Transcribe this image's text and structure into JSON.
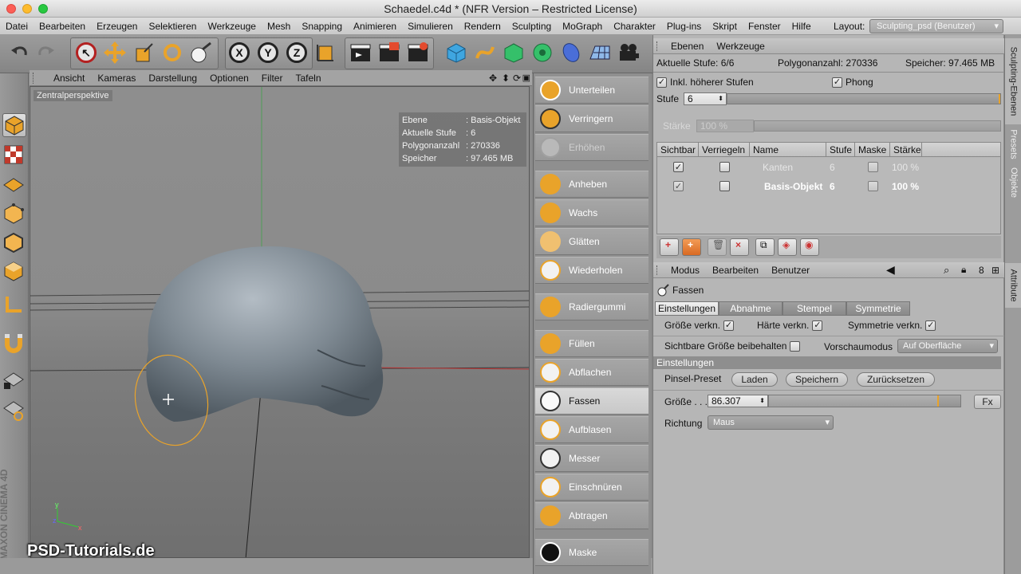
{
  "window": {
    "title": "Schaedel.c4d * (NFR Version – Restricted License)"
  },
  "menu": [
    "Datei",
    "Bearbeiten",
    "Erzeugen",
    "Selektieren",
    "Werkzeuge",
    "Mesh",
    "Snapping",
    "Animieren",
    "Simulieren",
    "Rendern",
    "Sculpting",
    "MoGraph",
    "Charakter",
    "Plug-ins",
    "Skript",
    "Fenster",
    "Hilfe"
  ],
  "layout": {
    "label": "Layout:",
    "value": "Sculpting_psd (Benutzer)"
  },
  "toolbar": {
    "x_label": "X",
    "y_label": "Y",
    "z_label": "Z"
  },
  "viewport": {
    "menu": [
      "Ansicht",
      "Kameras",
      "Darstellung",
      "Optionen",
      "Filter",
      "Tafeln"
    ],
    "perspective_label": "Zentralperspektive",
    "hud": [
      {
        "key": "Ebene",
        "value": ": Basis-Objekt"
      },
      {
        "key": "Aktuelle Stufe",
        "value": ": 6"
      },
      {
        "key": "Polygonanzahl",
        "value": ": 270336"
      },
      {
        "key": "Speicher",
        "value": ": 97.465 MB"
      }
    ]
  },
  "tools": [
    {
      "label": "Unterteilen",
      "state": "normal"
    },
    {
      "label": "Verringern",
      "state": "normal"
    },
    {
      "label": "Erhöhen",
      "state": "disabled"
    },
    {
      "label": "Anheben",
      "state": "normal"
    },
    {
      "label": "Wachs",
      "state": "normal"
    },
    {
      "label": "Glätten",
      "state": "normal"
    },
    {
      "label": "Wiederholen",
      "state": "normal"
    },
    {
      "label": "Radiergummi",
      "state": "normal"
    },
    {
      "label": "Füllen",
      "state": "normal"
    },
    {
      "label": "Abflachen",
      "state": "normal"
    },
    {
      "label": "Fassen",
      "state": "active"
    },
    {
      "label": "Aufblasen",
      "state": "normal"
    },
    {
      "label": "Messer",
      "state": "normal"
    },
    {
      "label": "Einschnüren",
      "state": "normal"
    },
    {
      "label": "Abtragen",
      "state": "normal"
    },
    {
      "label": "Maske",
      "state": "normal"
    }
  ],
  "layers_panel": {
    "menu": [
      "Ebenen",
      "Werkzeuge"
    ],
    "current_level_label": "Aktuelle Stufe: 6/6",
    "poly_count_label": "Polygonanzahl: 270336",
    "memory_label": "Speicher: 97.465 MB",
    "include_higher_label": "Inkl. höherer Stufen",
    "phong_label": "Phong",
    "level_label": "Stufe",
    "level_value": "6",
    "strength_label": "Stärke",
    "strength_value": "100 %",
    "columns": [
      "Sichtbar",
      "Verriegeln",
      "Name",
      "Stufe",
      "Maske",
      "Stärke"
    ],
    "rows": [
      {
        "name": "Kanten",
        "level": "6",
        "strength": "100 %",
        "disabled": true
      },
      {
        "name": "Basis-Objekt",
        "level": "6",
        "strength": "100 %",
        "disabled": false
      }
    ]
  },
  "attributes_panel": {
    "menu": [
      "Modus",
      "Bearbeiten",
      "Benutzer"
    ],
    "tool_name": "Fassen",
    "tabs": [
      {
        "label": "Einstellungen",
        "active": true
      },
      {
        "label": "Abnahme",
        "active": false
      },
      {
        "label": "Stempel",
        "active": false
      },
      {
        "label": "Symmetrie",
        "active": false
      }
    ],
    "link_size_label": "Größe verkn.",
    "link_hardness_label": "Härte verkn.",
    "link_symmetry_label": "Symmetrie verkn.",
    "keep_visible_size_label": "Sichtbare Größe beibehalten",
    "preview_mode_label": "Vorschaumodus",
    "preview_mode_value": "Auf Oberfläche",
    "section_title": "Einstellungen",
    "brush_preset_label": "Pinsel-Preset",
    "load_label": "Laden",
    "save_label": "Speichern",
    "reset_label": "Zurücksetzen",
    "size_label": "Größe . . .",
    "size_value": "86.307",
    "fx_label": "Fx",
    "direction_label": "Richtung",
    "direction_value": "Maus"
  },
  "side_tabs": [
    "Sculpting-Ebenen",
    "Presets",
    "Objekte",
    "Attribute"
  ],
  "brand": {
    "maxon": "MAXON CINEMA 4D",
    "watermark": "PSD-Tutorials.de"
  },
  "colors": {
    "accent_orange": "#e9a32a",
    "active_tool": "#d4d4d4",
    "panel": "#b6b6b6"
  }
}
